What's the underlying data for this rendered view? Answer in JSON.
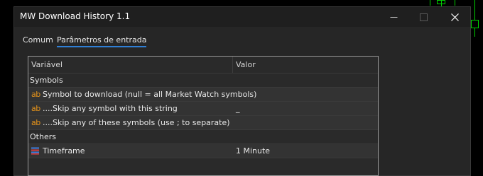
{
  "window": {
    "title": "MW Download History 1.1"
  },
  "tabs": [
    {
      "label": "Comum",
      "active": false
    },
    {
      "label": "Parâmetros de entrada",
      "active": true
    }
  ],
  "grid": {
    "columns": {
      "variable": "Variável",
      "value": "Valor"
    },
    "rows": [
      {
        "kind": "group",
        "label": "Symbols"
      },
      {
        "kind": "param",
        "icon": "ab-string-icon",
        "label": "Symbol to download (null = all Market Watch symbols)",
        "value": ""
      },
      {
        "kind": "param",
        "icon": "ab-string-icon",
        "label": "....Skip any symbol with this string",
        "value": "_"
      },
      {
        "kind": "param",
        "icon": "ab-string-icon",
        "label": "....Skip any of these symbols (use ; to separate)",
        "value": ""
      },
      {
        "kind": "group",
        "label": "Others"
      },
      {
        "kind": "param",
        "icon": "enum-list-icon",
        "label": "Timeframe",
        "value": "1 Minute"
      }
    ],
    "icon_text": {
      "ab": "ab"
    }
  },
  "colors": {
    "accent": "#2f7fd6",
    "string_icon": "#e5931b",
    "chart_candle": "#00d000"
  }
}
